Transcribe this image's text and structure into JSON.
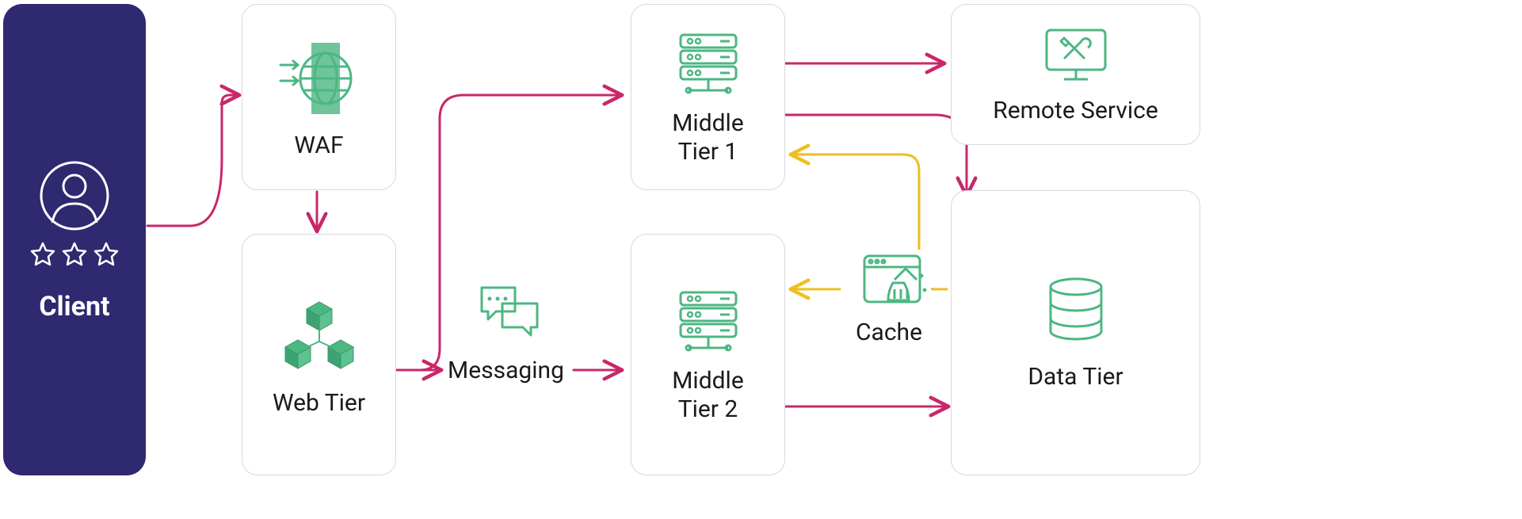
{
  "nodes": {
    "client": {
      "label": "Client"
    },
    "waf": {
      "label": "WAF"
    },
    "webtier": {
      "label": "Web Tier"
    },
    "messaging": {
      "label": "Messaging"
    },
    "middle1": {
      "label_line1": "Middle",
      "label_line2": "Tier 1"
    },
    "middle2": {
      "label_line1": "Middle",
      "label_line2": "Tier 2"
    },
    "cache": {
      "label": "Cache"
    },
    "remote": {
      "label": "Remote Service"
    },
    "datatier": {
      "label": "Data Tier"
    }
  },
  "colors": {
    "client_bg": "#2f2970",
    "border": "#d8d8e0",
    "text": "#1a1a1a",
    "icon_green": "#4cb782",
    "arrow_pink": "#c9276a",
    "arrow_yellow": "#eebf1f"
  },
  "edges": [
    {
      "from": "client",
      "to": "waf",
      "color": "pink"
    },
    {
      "from": "waf",
      "to": "webtier",
      "color": "pink"
    },
    {
      "from": "webtier",
      "to": "middle1",
      "color": "pink"
    },
    {
      "from": "webtier",
      "to": "messaging",
      "color": "pink"
    },
    {
      "from": "messaging",
      "to": "middle2",
      "color": "pink"
    },
    {
      "from": "middle1",
      "to": "remote",
      "color": "pink"
    },
    {
      "from": "middle1",
      "to": "datatier",
      "color": "pink"
    },
    {
      "from": "middle2",
      "to": "datatier",
      "color": "pink"
    },
    {
      "from": "datatier",
      "to": "middle1",
      "via": "cache",
      "color": "yellow"
    },
    {
      "from": "datatier",
      "to": "middle2",
      "via": "cache",
      "color": "yellow"
    }
  ]
}
